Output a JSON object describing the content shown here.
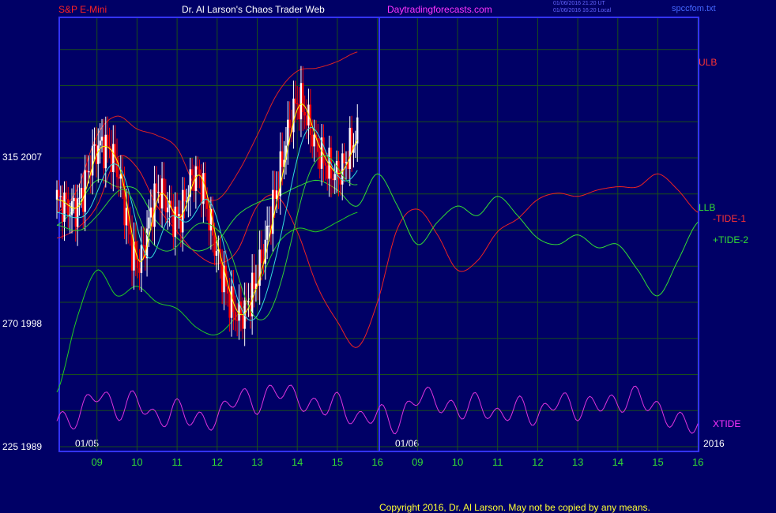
{
  "header": {
    "instrument": "S&P E-Mini",
    "title": "Dr. Al Larson's Chaos Trader Web",
    "site": "Daytradingforecasts.com",
    "stamp_line1": "01/06/2016 21:20 UT",
    "stamp_line2": "01/06/2016 16:20 Local",
    "file": "spccfom.txt"
  },
  "footer": {
    "copyright": "Copyright 2016, Dr. Al Larson. May not be copied by any means."
  },
  "colors": {
    "background": "#000066",
    "frame": "#3333ff",
    "grid": "#1a4d1a",
    "price": "#ffffff",
    "down_bar": "#ff0000",
    "ulb": "#dd2222",
    "llb": "#22cc22",
    "tide1": "#ee2222",
    "tide2": "#33dd33",
    "xtide": "#dd33dd",
    "ma_fast": "#ffff00",
    "ma_mid": "#33dddd",
    "ma_slow": "#33cc33"
  },
  "chart_data": {
    "type": "line",
    "y_left_labels": [
      {
        "value": 225,
        "price": 1989,
        "text": "225  1989"
      },
      {
        "value": 270,
        "price": 1998,
        "text": "270  1998"
      },
      {
        "value": 315,
        "price": 2007,
        "text": "315  2007"
      }
    ],
    "ylim": [
      225,
      360
    ],
    "x_ticks": [
      "09",
      "10",
      "11",
      "12",
      "13",
      "14",
      "15",
      "16",
      "09",
      "10",
      "11",
      "12",
      "13",
      "14",
      "15",
      "16"
    ],
    "date_labels": [
      "01/05",
      "01/06"
    ],
    "year_label": "2016",
    "series_labels": {
      "ulb": "ULB",
      "llb": "LLB",
      "tide1": "-TIDE-1",
      "tide2": "+TIDE-2",
      "xtide": "XTIDE"
    },
    "series": [
      {
        "name": "price_close",
        "x": [
          0,
          0.5,
          1,
          1.5,
          2,
          2.5,
          3,
          3.5,
          4,
          4.5,
          5,
          5.5,
          6,
          6.5,
          7,
          7.5
        ],
        "values": [
          302,
          300,
          318,
          312,
          282,
          304,
          296,
          310,
          285,
          266,
          278,
          306,
          332,
          318,
          310,
          322
        ]
      },
      {
        "name": "ULB",
        "x": [
          0,
          0.5,
          1,
          1.5,
          2,
          2.5,
          3,
          3.5,
          4,
          4.5,
          5,
          5.5,
          6,
          6.5,
          7,
          7.5
        ],
        "values": [
          298,
          305,
          322,
          328,
          324,
          322,
          318,
          305,
          302,
          310,
          322,
          335,
          342,
          343,
          345,
          348
        ]
      },
      {
        "name": "LLB",
        "x": [
          0,
          0.5,
          1,
          1.5,
          2,
          2.5,
          3,
          3.5,
          4,
          4.5,
          5,
          5.5,
          6,
          6.5,
          7,
          7.5
        ],
        "values": [
          242,
          265,
          280,
          272,
          275,
          270,
          268,
          262,
          260,
          266,
          275,
          288,
          293,
          292,
          295,
          298
        ]
      },
      {
        "name": "-TIDE-1",
        "x": [
          0,
          0.5,
          1,
          1.5,
          2,
          2.5,
          3,
          3.5,
          4,
          4.5,
          5,
          5.5,
          6,
          6.5,
          7,
          7.5,
          8,
          8.5,
          9,
          9.5,
          10,
          10.5,
          11,
          11.5,
          12,
          12.5,
          13,
          13.5,
          14,
          14.5,
          15,
          15.5,
          16
        ],
        "values": [
          290,
          293,
          300,
          315,
          312,
          300,
          292,
          285,
          282,
          286,
          300,
          303,
          292,
          275,
          264,
          256,
          270,
          293,
          299,
          291,
          280,
          283,
          292,
          296,
          302,
          304,
          303,
          305,
          306,
          306,
          310,
          305,
          298
        ]
      },
      {
        "name": "+TIDE-2",
        "x": [
          0,
          0.5,
          1,
          1.5,
          2,
          2.5,
          3,
          3.5,
          4,
          4.5,
          5,
          5.5,
          6,
          6.5,
          7,
          7.5,
          8,
          8.5,
          9,
          9.5,
          10,
          10.5,
          11,
          11.5,
          12,
          12.5,
          13,
          13.5,
          14,
          14.5,
          15,
          15.5,
          16
        ],
        "values": [
          294,
          300,
          308,
          306,
          305,
          295,
          290,
          286,
          289,
          297,
          301,
          303,
          306,
          308,
          305,
          300,
          310,
          300,
          288,
          295,
          300,
          297,
          303,
          297,
          290,
          288,
          291,
          287,
          288,
          280,
          272,
          283,
          295
        ]
      },
      {
        "name": "XTIDE",
        "x": [
          0,
          0.5,
          1,
          1.5,
          2,
          2.5,
          3,
          3.5,
          4,
          4.5,
          5,
          5.5,
          6,
          6.5,
          7,
          7.5,
          8,
          8.5,
          9,
          9.5,
          10,
          10.5,
          11,
          11.5,
          12,
          12.5,
          13,
          13.5,
          14,
          14.5,
          15,
          15.5,
          16
        ],
        "values": [
          233,
          234,
          242,
          236,
          240,
          233,
          237,
          233,
          234,
          241,
          238,
          243,
          240,
          237,
          239,
          233,
          236,
          232,
          241,
          239,
          236,
          239,
          234,
          238,
          234,
          240,
          236,
          239,
          238,
          241,
          236,
          233,
          232
        ]
      }
    ]
  }
}
